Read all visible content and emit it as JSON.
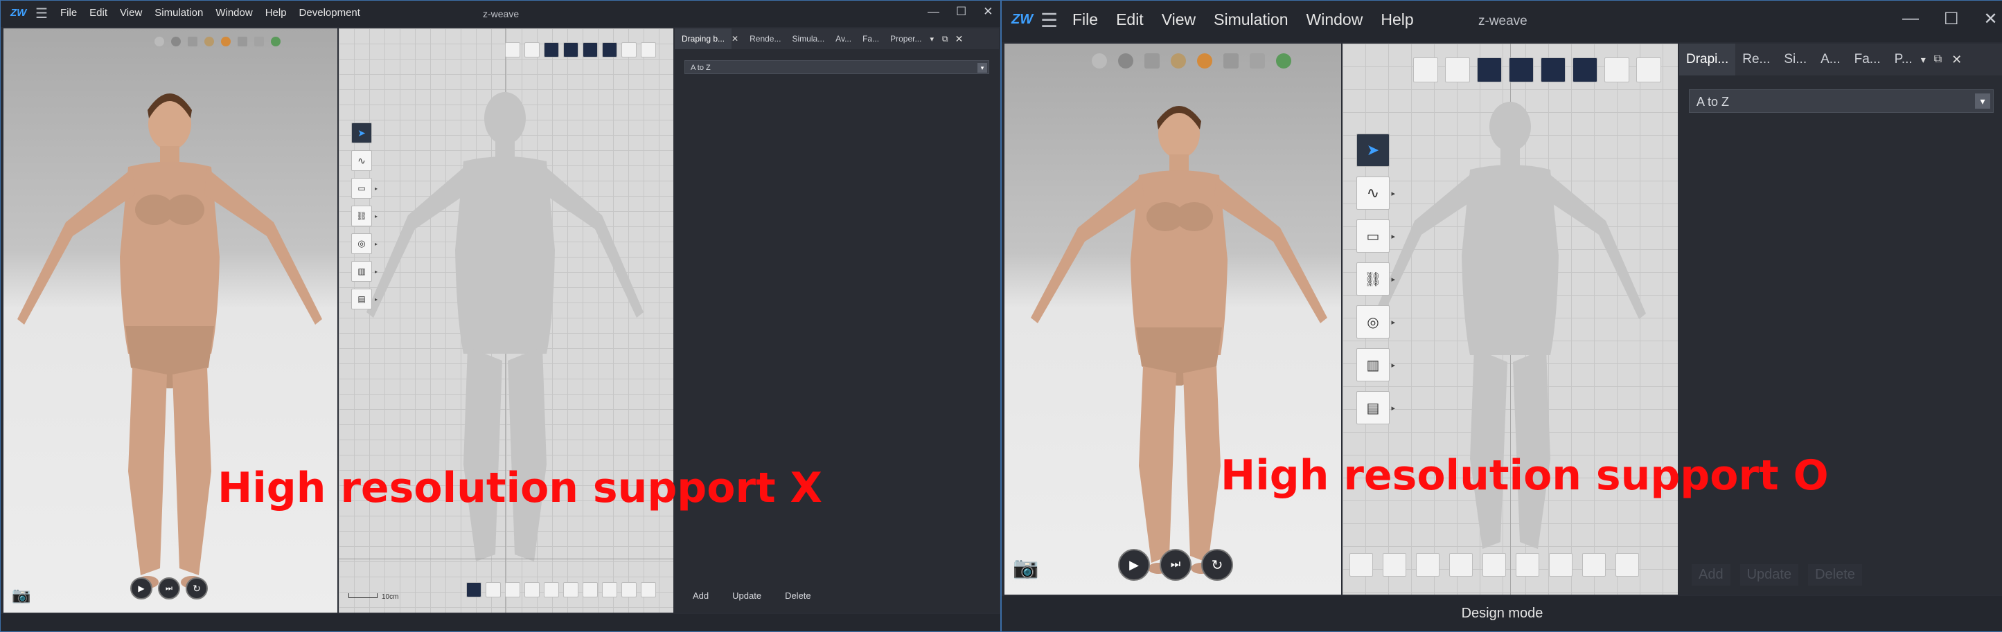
{
  "left": {
    "menu": [
      "File",
      "Edit",
      "View",
      "Simulation",
      "Window",
      "Help",
      "Development"
    ],
    "window_title": "z-weave",
    "tabs": [
      "Draping b...",
      "Rende...",
      "Simula...",
      "Av...",
      "Fa...",
      "Proper..."
    ],
    "sort_value": "A to Z",
    "buttons": {
      "add": "Add",
      "update": "Update",
      "delete": "Delete"
    },
    "scale_label": "10cm",
    "overlay_text": "High resolution support X"
  },
  "right": {
    "menu": [
      "File",
      "Edit",
      "View",
      "Simulation",
      "Window",
      "Help"
    ],
    "window_title": "z-weave",
    "tabs": [
      "Drapi...",
      "Re...",
      "Si...",
      "A...",
      "Fa...",
      "P..."
    ],
    "sort_value": "A to Z",
    "buttons": {
      "add": "Add",
      "update": "Update",
      "delete": "Delete"
    },
    "status": "Design mode",
    "overlay_text": "High resolution support O"
  },
  "icons": {
    "app_logo": "zw-logo-icon",
    "menu": "hamburger-icon",
    "camera": "camera-icon",
    "play": "play-icon",
    "step": "step-forward-icon",
    "reset": "reset-icon"
  },
  "colors": {
    "accent": "#3ea0ff",
    "overlay": "#ff0d0d",
    "panel": "#292c33"
  }
}
